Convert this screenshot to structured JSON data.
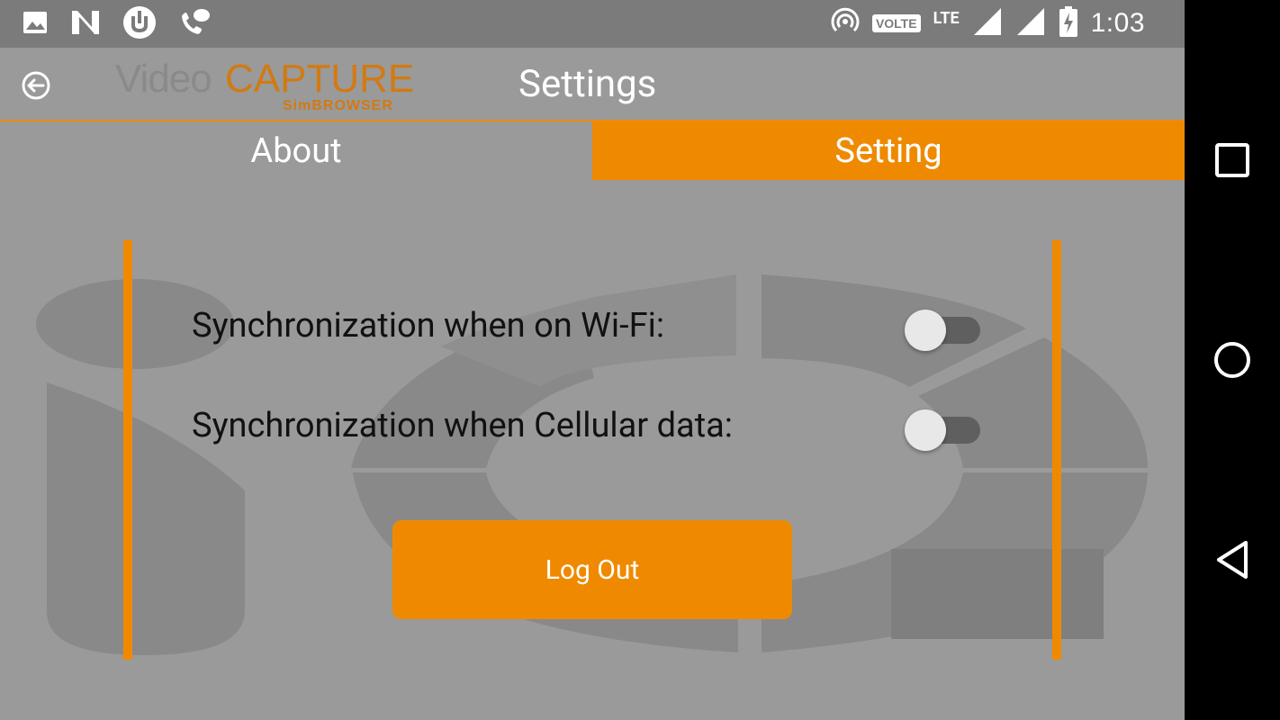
{
  "status_bar": {
    "time": "1:03",
    "volte": "VOLTE",
    "network": "LTE",
    "icons": [
      "image-icon",
      "n-app-icon",
      "utorrent-icon",
      "wifi-call-icon",
      "hotspot-icon",
      "signal-icon",
      "signal-icon",
      "battery-charging-icon"
    ]
  },
  "header": {
    "logo_part1": "Video",
    "logo_part2": "CAPTURE",
    "logo_sub": "SimBROWSER",
    "title": "Settings"
  },
  "tabs": [
    {
      "label": "About",
      "active": false
    },
    {
      "label": "Setting",
      "active": true
    }
  ],
  "settings": {
    "wifi_sync_label": "Synchronization when on Wi-Fi:",
    "wifi_sync_enabled": false,
    "cellular_sync_label": "Synchronization when Cellular data:",
    "cellular_sync_enabled": false
  },
  "logout_label": "Log Out",
  "colors": {
    "accent": "#ef8a00",
    "background": "#9a9a9a",
    "statusbar": "#7b7b7b",
    "navbar": "#000000"
  }
}
